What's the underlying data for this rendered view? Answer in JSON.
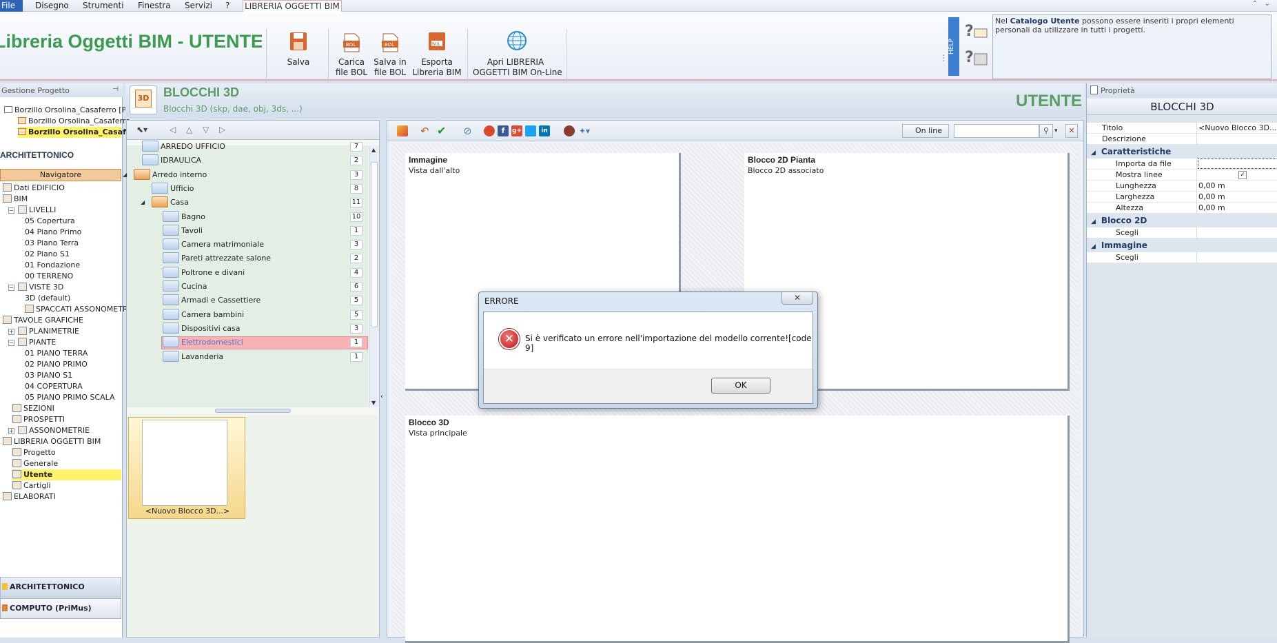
{
  "menu": {
    "file": "File",
    "items": [
      "Disegno",
      "Strumenti",
      "Finestra",
      "Servizi",
      "?"
    ],
    "active_tab": "LIBRERIA OGGETTI BIM"
  },
  "ribbon": {
    "app_title": "Libreria Oggetti BIM - UTENTE",
    "buttons": [
      {
        "label": "Salva"
      },
      {
        "label": "Carica\nfile BOL"
      },
      {
        "label": "Salva in\nfile BOL"
      },
      {
        "label": "Esporta\nLibreria BIM"
      },
      {
        "label": "Apri LIBRERIA\nOGGETTI BIM On-Line"
      }
    ],
    "help_label": "HELP",
    "help_text_pre": "Nel ",
    "help_text_bold": "Catalogo Utente",
    "help_text_post": " possono essere inseriti i propri elementi personali da utilizzare in tutti i progetti."
  },
  "left_panel": {
    "header": "Gestione Progetto",
    "projects": [
      "Borzillo Orsolina_Casaferro [PG",
      "Borzillo Orsolina_Casaferro",
      "Borzillo Orsolina_Casaf"
    ],
    "section": "ARCHITETTONICO",
    "navigator": "Navigatore",
    "tree": [
      "Dati EDIFICIO",
      "BIM",
      "LIVELLI",
      "05 Copertura",
      "04 Piano Primo",
      "03 Piano Terra",
      "02 Piano S1",
      "01 Fondazione",
      "00 TERRENO",
      "VISTE 3D",
      "3D (default)",
      "SPACCATI ASSONOMETRICI",
      "TAVOLE GRAFICHE",
      "PLANIMETRIE",
      "PIANTE",
      "01 PIANO TERRA",
      "02 PIANO PRIMO",
      "03 PIANO S1",
      "04 COPERTURA",
      "05 PIANO PRIMO SCALA",
      "SEZIONI",
      "PROSPETTI",
      "ASSONOMETRIE",
      "LIBRERIA OGGETTI BIM",
      "Progetto",
      "Generale",
      "Utente",
      "Cartigli",
      "ELABORATI"
    ],
    "bottom_tabs": [
      "ARCHITETTONICO",
      "COMPUTO (PriMus)"
    ]
  },
  "header": {
    "title": "BLOCCHI 3D",
    "subtitle": "Blocchi 3D (skp, dae, obj, 3ds, ...)",
    "right": "UTENTE",
    "icon_text": "3D"
  },
  "folders": [
    {
      "name": "ARREDO UFFICIO",
      "count": "7"
    },
    {
      "name": "IDRAULICA",
      "count": "2"
    },
    {
      "name": "Arredo interno",
      "count": "3"
    },
    {
      "name": "Ufficio",
      "count": "8"
    },
    {
      "name": "Casa",
      "count": "11"
    },
    {
      "name": "Bagno",
      "count": "10"
    },
    {
      "name": "Tavoli",
      "count": "1"
    },
    {
      "name": "Camera matrimoniale",
      "count": "3"
    },
    {
      "name": "Pareti attrezzate salone",
      "count": "2"
    },
    {
      "name": "Poltrone e divani",
      "count": "4"
    },
    {
      "name": "Cucina",
      "count": "6"
    },
    {
      "name": "Armadi e Cassettiere",
      "count": "5"
    },
    {
      "name": "Camera bambini",
      "count": "5"
    },
    {
      "name": "Dispositivi casa",
      "count": "3"
    },
    {
      "name": "Elettrodomestici",
      "count": "1"
    },
    {
      "name": "Lavanderia",
      "count": "1"
    }
  ],
  "thumbnail": {
    "label": "<Nuovo Blocco 3D...>"
  },
  "center": {
    "online_label": "On line",
    "boxes": [
      {
        "title": "Immagine",
        "subtitle": "Vista dall'alto"
      },
      {
        "title": "Blocco 2D Pianta",
        "subtitle": "Blocco 2D associato"
      },
      {
        "title": "Blocco 3D",
        "subtitle": "Vista principale"
      }
    ]
  },
  "properties": {
    "header": "Proprietà",
    "title": "BLOCCHI 3D",
    "rows": [
      {
        "key": "Titolo",
        "value": "<Nuovo Blocco 3D...>"
      },
      {
        "key": "Descrizione",
        "value": ""
      }
    ],
    "cat1": "Caratteristiche",
    "cat1_rows": [
      {
        "key": "Importa da file",
        "value": ""
      },
      {
        "key": "Mostra linee",
        "value": "✓"
      },
      {
        "key": "Lunghezza",
        "value": "0,00 m"
      },
      {
        "key": "Larghezza",
        "value": "0,00 m"
      },
      {
        "key": "Altezza",
        "value": "0,00 m"
      }
    ],
    "cat2": "Blocco 2D",
    "cat2_rows": [
      {
        "key": "Scegli",
        "value": ""
      }
    ],
    "cat3": "Immagine",
    "cat3_rows": [
      {
        "key": "Scegli",
        "value": ""
      }
    ]
  },
  "dialog": {
    "title": "ERRORE",
    "close": "✕",
    "message": "Si è verificato un errore nell'importazione del modello corrente![code 9]",
    "ok": "OK",
    "icon": "✕"
  },
  "colors": {
    "accent_green": "#3d9a52",
    "error_red": "#c31414",
    "selection_red": "#f6b2b4"
  }
}
